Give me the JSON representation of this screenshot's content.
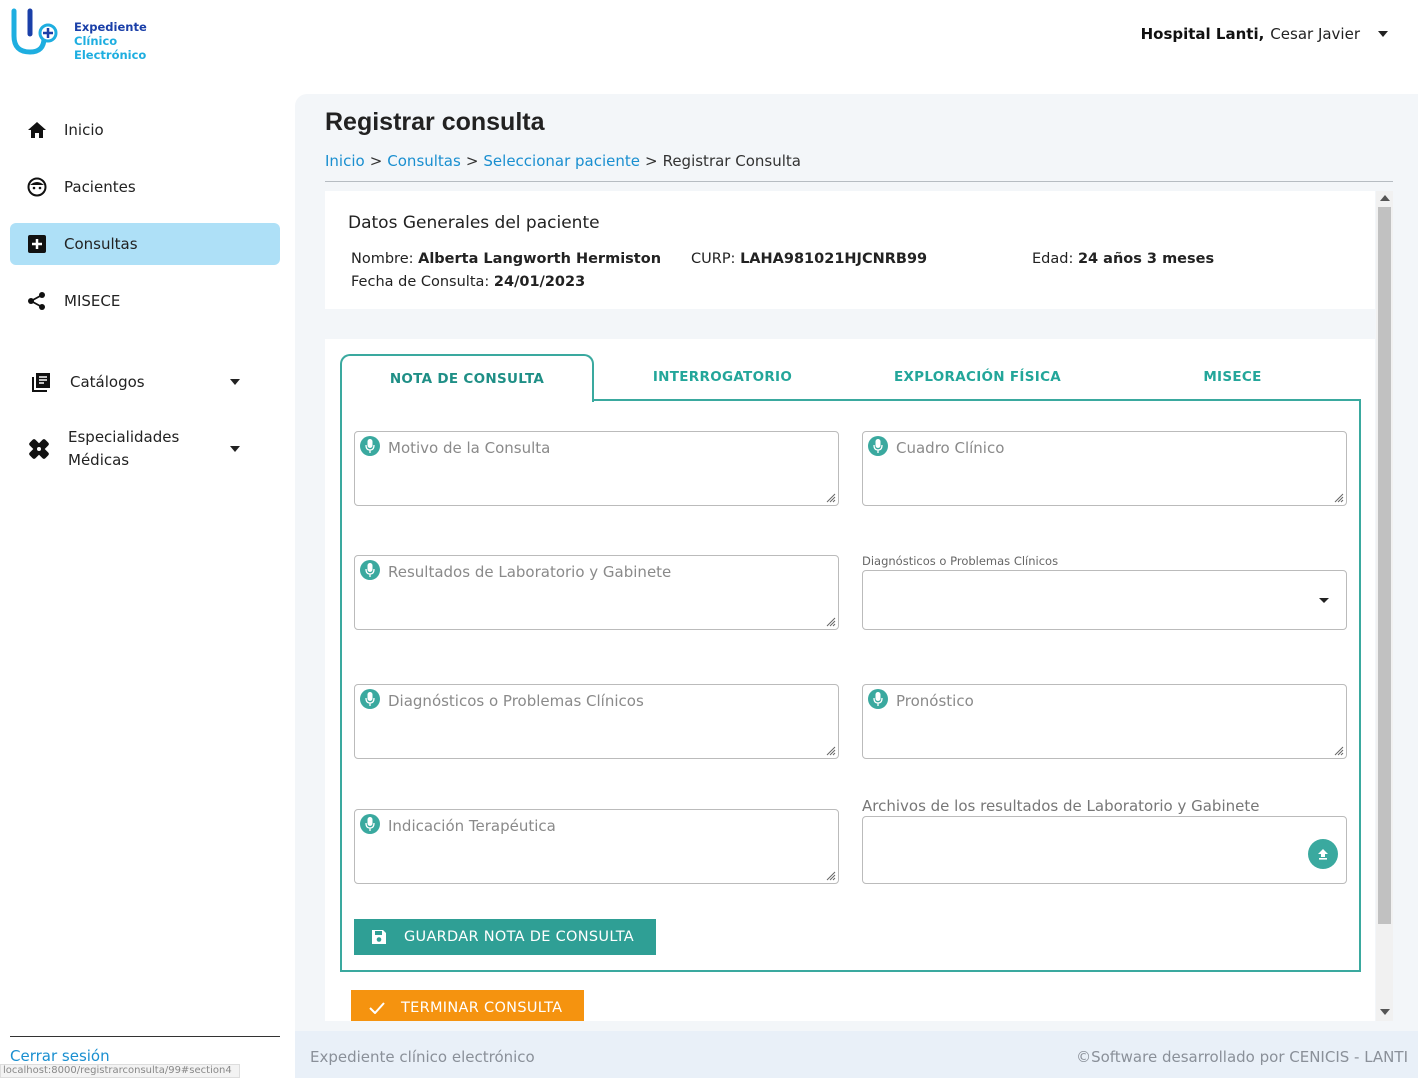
{
  "app": {
    "logo_line1": "Expediente",
    "logo_line2": "Clínico",
    "logo_line3": "Electrónico"
  },
  "user": {
    "hospital": "Hospital Lanti,",
    "name": "Cesar Javier"
  },
  "sidebar": {
    "items": [
      {
        "label": "Inicio",
        "icon": "home-icon"
      },
      {
        "label": "Pacientes",
        "icon": "face-icon"
      },
      {
        "label": "Consultas",
        "icon": "medical-plus-icon",
        "active": true
      },
      {
        "label": "MISECE",
        "icon": "share-icon"
      },
      {
        "label": "Catálogos",
        "icon": "library-books-icon"
      },
      {
        "label": "Especialidades",
        "label2": "Médicas",
        "icon": "healing-icon"
      }
    ],
    "logout": "Cerrar sesión"
  },
  "status_url": "localhost:8000/registrarconsulta/99#section4",
  "page": {
    "title": "Registrar consulta",
    "breadcrumb": [
      "Inicio",
      "Consultas",
      "Seleccionar paciente",
      "Registrar Consulta"
    ],
    "breadcrumb_sep": ">"
  },
  "patient": {
    "card_title": "Datos Generales del paciente",
    "name_label": "Nombre:",
    "name": "Alberta Langworth Hermiston",
    "curp_label": "CURP:",
    "curp": "LAHA981021HJCNRB99",
    "age_label": "Edad:",
    "age": "24 años 3 meses",
    "date_label": "Fecha de Consulta:",
    "date": "24/01/2023"
  },
  "tabs": [
    "NOTA DE CONSULTA",
    "INTERROGATORIO",
    "EXPLORACIÓN FÍSICA",
    "MISECE"
  ],
  "form": {
    "motivo": "Motivo de la Consulta",
    "cuadro": "Cuadro Clínico",
    "resultados": "Resultados de Laboratorio y Gabinete",
    "diag_select_label": "Diagnósticos o Problemas Clínicos",
    "diagnosticos": "Diagnósticos o Problemas Clínicos",
    "pronostico": "Pronóstico",
    "indicacion": "Indicación Terapéutica",
    "archivos_label": "Archivos de los resultados de Laboratorio y Gabinete",
    "save_button": "GUARDAR NOTA DE CONSULTA"
  },
  "finish_button": "TERMINAR CONSULTA",
  "footer": {
    "left": "Expediente clínico electrónico",
    "right": "©Software desarrollado por CENICIS - LANTI"
  },
  "colors": {
    "accent": "#3aa99f",
    "active_nav": "#aee0f7",
    "link": "#1a8fd0",
    "finish": "#f5930f"
  }
}
